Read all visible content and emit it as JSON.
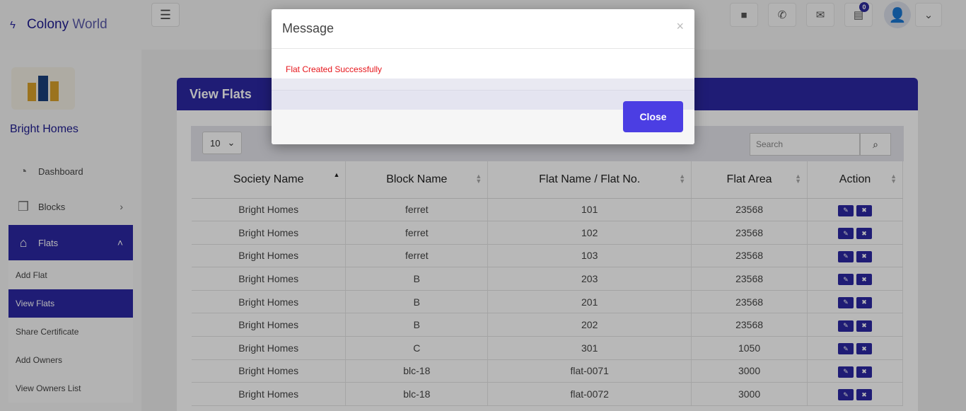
{
  "brand": {
    "name": "Colony",
    "suffix": " World"
  },
  "org_name": "Bright Homes",
  "topbar": {
    "notification_count": "0"
  },
  "sidebar": {
    "items": [
      {
        "label": "Dashboard",
        "icon": "dashboard-icon"
      },
      {
        "label": "Blocks",
        "icon": "blocks-icon"
      },
      {
        "label": "Flats",
        "icon": "home-icon"
      }
    ],
    "sub_items": [
      "Add Flat",
      "View Flats",
      "Share Certificate",
      "Add Owners",
      "View Owners List"
    ]
  },
  "main": {
    "card_title": "View Flats",
    "page_length": "10",
    "search_placeholder": "Search",
    "table": {
      "headers": [
        "Society Name",
        "Block Name",
        "Flat Name / Flat No.",
        "Flat Area",
        "Action"
      ],
      "rows": [
        [
          "Bright Homes",
          "ferret",
          "101",
          "23568"
        ],
        [
          "Bright Homes",
          "ferret",
          "102",
          "23568"
        ],
        [
          "Bright Homes",
          "ferret",
          "103",
          "23568"
        ],
        [
          "Bright Homes",
          "B",
          "203",
          "23568"
        ],
        [
          "Bright Homes",
          "B",
          "201",
          "23568"
        ],
        [
          "Bright Homes",
          "B",
          "202",
          "23568"
        ],
        [
          "Bright Homes",
          "C",
          "301",
          "1050"
        ],
        [
          "Bright Homes",
          "blc-18",
          "flat-0071",
          "3000"
        ],
        [
          "Bright Homes",
          "blc-18",
          "flat-0072",
          "3000"
        ]
      ]
    }
  },
  "modal": {
    "title": "Message",
    "close_symbol": "×",
    "message": "Flat Created Successfully",
    "close_label": "Close"
  },
  "colors": {
    "primary": "#2b27a2",
    "button": "#4b3ee3",
    "message": "#e6151b"
  }
}
